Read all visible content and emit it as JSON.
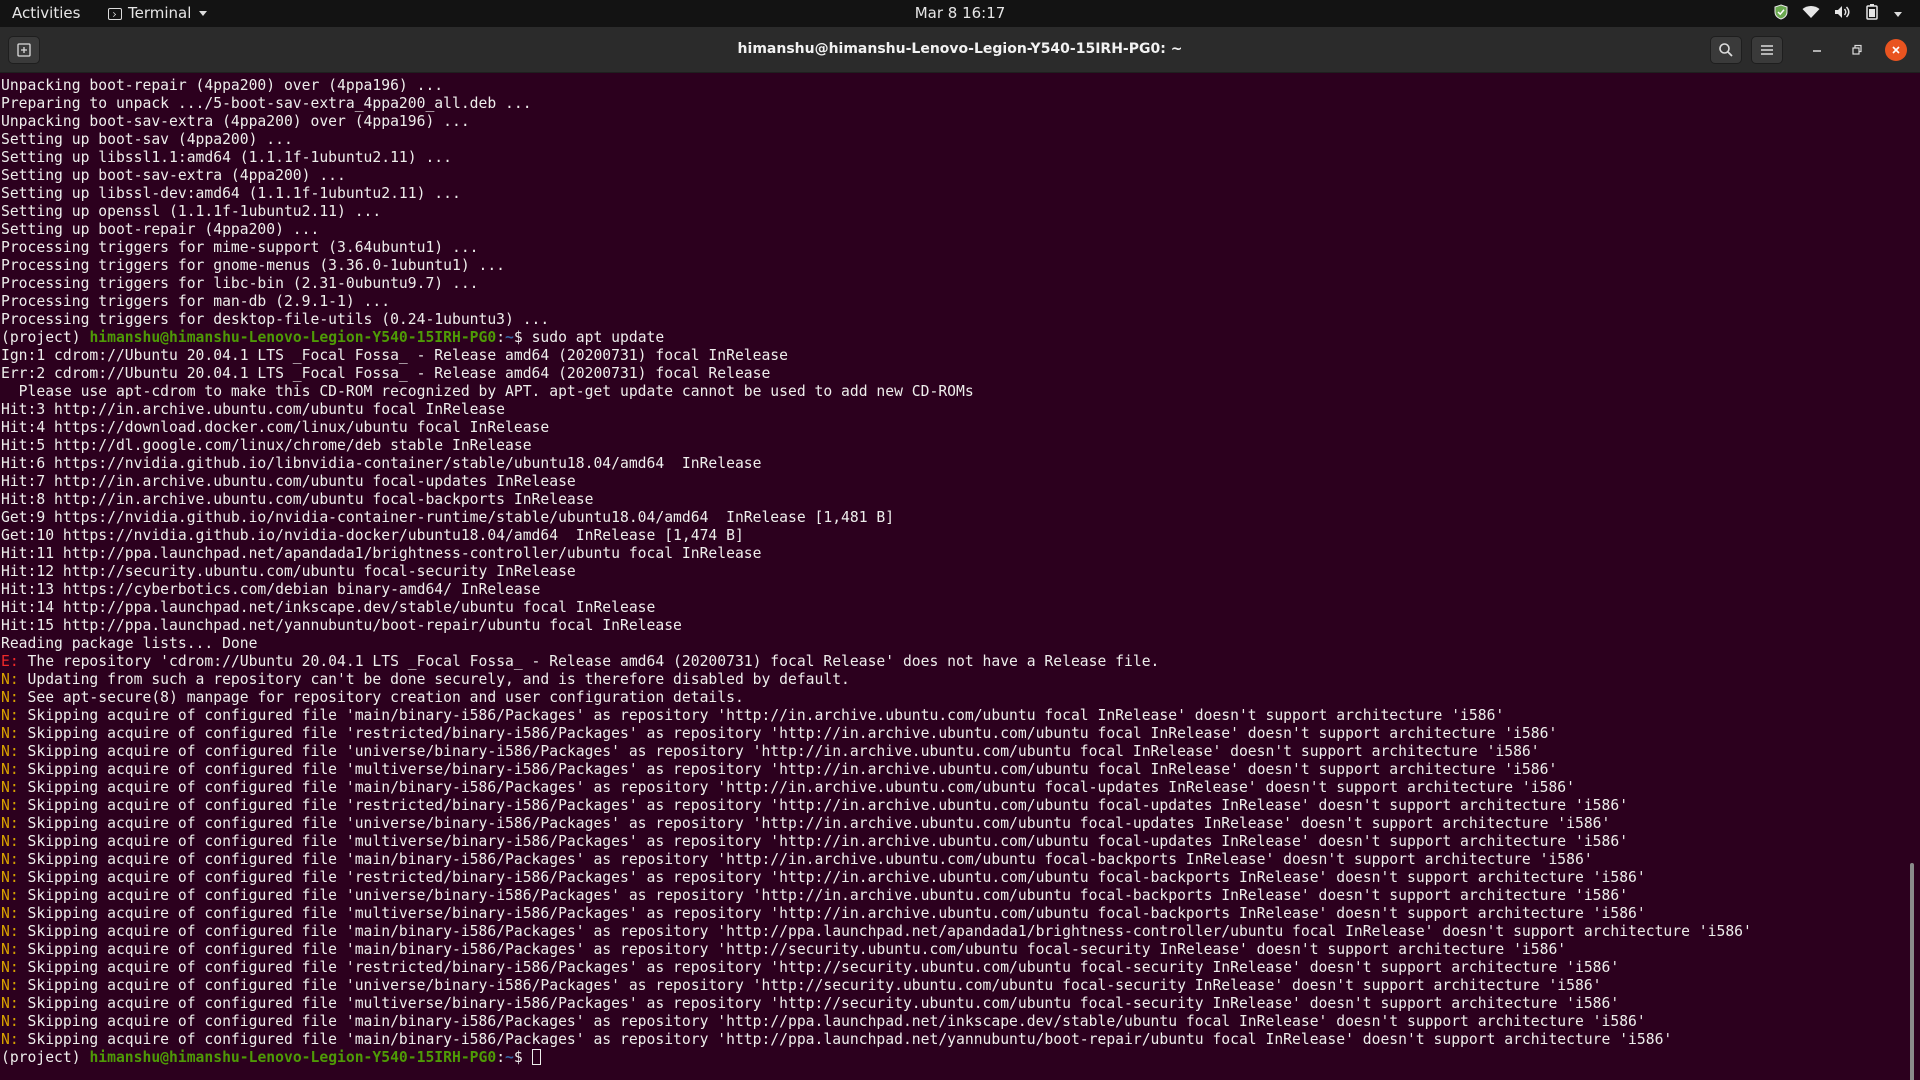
{
  "topbar": {
    "activities": "Activities",
    "app_name": "Terminal",
    "clock": "Mar 8  16:17",
    "icons": [
      "shield-icon",
      "wifi-icon",
      "volume-icon",
      "battery-icon",
      "system-menu-arrow-icon"
    ]
  },
  "window": {
    "title": "himanshu@himanshu-Lenovo-Legion-Y540-15IRH-PG0: ~",
    "buttons": [
      "new-tab-icon",
      "search-icon",
      "hamburger-menu-icon",
      "minimize-icon",
      "maximize-icon",
      "close-icon"
    ]
  },
  "terminal": {
    "colors": {
      "background": "#2c001e",
      "foreground": "#eeeeec",
      "prompt_user": "#4e9a06",
      "prompt_path": "#3465a4",
      "error_tag": "#ef2929",
      "notice_tag": "#d7a100"
    },
    "lines": [
      {
        "tag": "",
        "text": "Unpacking boot-repair (4ppa200) over (4ppa196) ..."
      },
      {
        "tag": "",
        "text": "Preparing to unpack .../5-boot-sav-extra_4ppa200_all.deb ..."
      },
      {
        "tag": "",
        "text": "Unpacking boot-sav-extra (4ppa200) over (4ppa196) ..."
      },
      {
        "tag": "",
        "text": "Setting up boot-sav (4ppa200) ..."
      },
      {
        "tag": "",
        "text": "Setting up libssl1.1:amd64 (1.1.1f-1ubuntu2.11) ..."
      },
      {
        "tag": "",
        "text": "Setting up boot-sav-extra (4ppa200) ..."
      },
      {
        "tag": "",
        "text": "Setting up libssl-dev:amd64 (1.1.1f-1ubuntu2.11) ..."
      },
      {
        "tag": "",
        "text": "Setting up openssl (1.1.1f-1ubuntu2.11) ..."
      },
      {
        "tag": "",
        "text": "Setting up boot-repair (4ppa200) ..."
      },
      {
        "tag": "",
        "text": "Processing triggers for mime-support (3.64ubuntu1) ..."
      },
      {
        "tag": "",
        "text": "Processing triggers for gnome-menus (3.36.0-1ubuntu1) ..."
      },
      {
        "tag": "",
        "text": "Processing triggers for libc-bin (2.31-0ubuntu9.7) ..."
      },
      {
        "tag": "",
        "text": "Processing triggers for man-db (2.9.1-1) ..."
      },
      {
        "tag": "",
        "text": "Processing triggers for desktop-file-utils (0.24-1ubuntu3) ..."
      },
      {
        "tag": "prompt",
        "env": "(project) ",
        "user": "himanshu@himanshu-Lenovo-Legion-Y540-15IRH-PG0",
        "sep": ":",
        "path": "~",
        "dollar": "$ ",
        "text": "sudo apt update"
      },
      {
        "tag": "",
        "text": "Ign:1 cdrom://Ubuntu 20.04.1 LTS _Focal Fossa_ - Release amd64 (20200731) focal InRelease"
      },
      {
        "tag": "",
        "text": "Err:2 cdrom://Ubuntu 20.04.1 LTS _Focal Fossa_ - Release amd64 (20200731) focal Release"
      },
      {
        "tag": "",
        "text": "  Please use apt-cdrom to make this CD-ROM recognized by APT. apt-get update cannot be used to add new CD-ROMs"
      },
      {
        "tag": "",
        "text": "Hit:3 http://in.archive.ubuntu.com/ubuntu focal InRelease"
      },
      {
        "tag": "",
        "text": "Hit:4 https://download.docker.com/linux/ubuntu focal InRelease"
      },
      {
        "tag": "",
        "text": "Hit:5 http://dl.google.com/linux/chrome/deb stable InRelease"
      },
      {
        "tag": "",
        "text": "Hit:6 https://nvidia.github.io/libnvidia-container/stable/ubuntu18.04/amd64  InRelease"
      },
      {
        "tag": "",
        "text": "Hit:7 http://in.archive.ubuntu.com/ubuntu focal-updates InRelease"
      },
      {
        "tag": "",
        "text": "Hit:8 http://in.archive.ubuntu.com/ubuntu focal-backports InRelease"
      },
      {
        "tag": "",
        "text": "Get:9 https://nvidia.github.io/nvidia-container-runtime/stable/ubuntu18.04/amd64  InRelease [1,481 B]"
      },
      {
        "tag": "",
        "text": "Get:10 https://nvidia.github.io/nvidia-docker/ubuntu18.04/amd64  InRelease [1,474 B]"
      },
      {
        "tag": "",
        "text": "Hit:11 http://ppa.launchpad.net/apandada1/brightness-controller/ubuntu focal InRelease"
      },
      {
        "tag": "",
        "text": "Hit:12 http://security.ubuntu.com/ubuntu focal-security InRelease"
      },
      {
        "tag": "",
        "text": "Hit:13 https://cyberbotics.com/debian binary-amd64/ InRelease"
      },
      {
        "tag": "",
        "text": "Hit:14 http://ppa.launchpad.net/inkscape.dev/stable/ubuntu focal InRelease"
      },
      {
        "tag": "",
        "text": "Hit:15 http://ppa.launchpad.net/yannubuntu/boot-repair/ubuntu focal InRelease"
      },
      {
        "tag": "",
        "text": "Reading package lists... Done"
      },
      {
        "tag": "E:",
        "text": " The repository 'cdrom://Ubuntu 20.04.1 LTS _Focal Fossa_ - Release amd64 (20200731) focal Release' does not have a Release file."
      },
      {
        "tag": "N:",
        "text": " Updating from such a repository can't be done securely, and is therefore disabled by default."
      },
      {
        "tag": "N:",
        "text": " See apt-secure(8) manpage for repository creation and user configuration details."
      },
      {
        "tag": "N:",
        "text": " Skipping acquire of configured file 'main/binary-i586/Packages' as repository 'http://in.archive.ubuntu.com/ubuntu focal InRelease' doesn't support architecture 'i586'"
      },
      {
        "tag": "N:",
        "text": " Skipping acquire of configured file 'restricted/binary-i586/Packages' as repository 'http://in.archive.ubuntu.com/ubuntu focal InRelease' doesn't support architecture 'i586'"
      },
      {
        "tag": "N:",
        "text": " Skipping acquire of configured file 'universe/binary-i586/Packages' as repository 'http://in.archive.ubuntu.com/ubuntu focal InRelease' doesn't support architecture 'i586'"
      },
      {
        "tag": "N:",
        "text": " Skipping acquire of configured file 'multiverse/binary-i586/Packages' as repository 'http://in.archive.ubuntu.com/ubuntu focal InRelease' doesn't support architecture 'i586'"
      },
      {
        "tag": "N:",
        "text": " Skipping acquire of configured file 'main/binary-i586/Packages' as repository 'http://in.archive.ubuntu.com/ubuntu focal-updates InRelease' doesn't support architecture 'i586'"
      },
      {
        "tag": "N:",
        "text": " Skipping acquire of configured file 'restricted/binary-i586/Packages' as repository 'http://in.archive.ubuntu.com/ubuntu focal-updates InRelease' doesn't support architecture 'i586'"
      },
      {
        "tag": "N:",
        "text": " Skipping acquire of configured file 'universe/binary-i586/Packages' as repository 'http://in.archive.ubuntu.com/ubuntu focal-updates InRelease' doesn't support architecture 'i586'"
      },
      {
        "tag": "N:",
        "text": " Skipping acquire of configured file 'multiverse/binary-i586/Packages' as repository 'http://in.archive.ubuntu.com/ubuntu focal-updates InRelease' doesn't support architecture 'i586'"
      },
      {
        "tag": "N:",
        "text": " Skipping acquire of configured file 'main/binary-i586/Packages' as repository 'http://in.archive.ubuntu.com/ubuntu focal-backports InRelease' doesn't support architecture 'i586'"
      },
      {
        "tag": "N:",
        "text": " Skipping acquire of configured file 'restricted/binary-i586/Packages' as repository 'http://in.archive.ubuntu.com/ubuntu focal-backports InRelease' doesn't support architecture 'i586'"
      },
      {
        "tag": "N:",
        "text": " Skipping acquire of configured file 'universe/binary-i586/Packages' as repository 'http://in.archive.ubuntu.com/ubuntu focal-backports InRelease' doesn't support architecture 'i586'"
      },
      {
        "tag": "N:",
        "text": " Skipping acquire of configured file 'multiverse/binary-i586/Packages' as repository 'http://in.archive.ubuntu.com/ubuntu focal-backports InRelease' doesn't support architecture 'i586'"
      },
      {
        "tag": "N:",
        "text": " Skipping acquire of configured file 'main/binary-i586/Packages' as repository 'http://ppa.launchpad.net/apandada1/brightness-controller/ubuntu focal InRelease' doesn't support architecture 'i586'"
      },
      {
        "tag": "N:",
        "text": " Skipping acquire of configured file 'main/binary-i586/Packages' as repository 'http://security.ubuntu.com/ubuntu focal-security InRelease' doesn't support architecture 'i586'"
      },
      {
        "tag": "N:",
        "text": " Skipping acquire of configured file 'restricted/binary-i586/Packages' as repository 'http://security.ubuntu.com/ubuntu focal-security InRelease' doesn't support architecture 'i586'"
      },
      {
        "tag": "N:",
        "text": " Skipping acquire of configured file 'universe/binary-i586/Packages' as repository 'http://security.ubuntu.com/ubuntu focal-security InRelease' doesn't support architecture 'i586'"
      },
      {
        "tag": "N:",
        "text": " Skipping acquire of configured file 'multiverse/binary-i586/Packages' as repository 'http://security.ubuntu.com/ubuntu focal-security InRelease' doesn't support architecture 'i586'"
      },
      {
        "tag": "N:",
        "text": " Skipping acquire of configured file 'main/binary-i586/Packages' as repository 'http://ppa.launchpad.net/inkscape.dev/stable/ubuntu focal InRelease' doesn't support architecture 'i586'"
      },
      {
        "tag": "N:",
        "text": " Skipping acquire of configured file 'main/binary-i586/Packages' as repository 'http://ppa.launchpad.net/yannubuntu/boot-repair/ubuntu focal InRelease' doesn't support architecture 'i586'"
      },
      {
        "tag": "prompt",
        "env": "(project) ",
        "user": "himanshu@himanshu-Lenovo-Legion-Y540-15IRH-PG0",
        "sep": ":",
        "path": "~",
        "dollar": "$ ",
        "text": "",
        "cursor": true
      }
    ]
  }
}
